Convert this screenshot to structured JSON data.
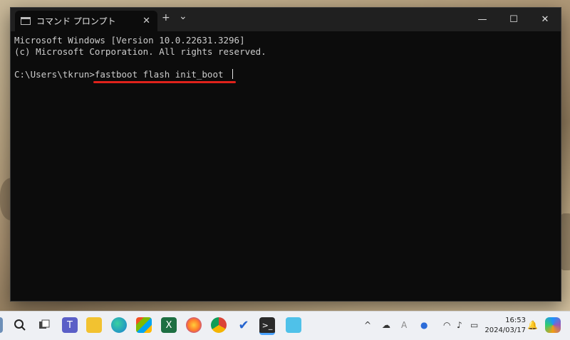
{
  "window": {
    "tab_title": "コマンド プロンプト",
    "tab_close": "✕",
    "new_tab": "+",
    "dropdown": "⌄",
    "minimize": "—",
    "maximize": "☐",
    "close": "✕"
  },
  "terminal": {
    "line1": "Microsoft Windows [Version 10.0.22631.3296]",
    "line2": "(c) Microsoft Corporation. All rights reserved.",
    "prompt": "C:\\Users\\tkrun>",
    "command": "fastboot flash init_boot "
  },
  "taskbar": {
    "time": "16:53",
    "date": "2024/03/17",
    "icons": [
      "windows-start-icon",
      "search-icon",
      "task-view-icon",
      "teams-icon",
      "file-explorer-icon",
      "edge-icon",
      "store-icon",
      "excel-icon",
      "firefox-icon",
      "chrome-icon",
      "todo-icon",
      "terminal-icon",
      "notepad-icon"
    ],
    "tray_chevron": "^",
    "ime": "A",
    "colors": {
      "accent": "#e0221b"
    }
  }
}
